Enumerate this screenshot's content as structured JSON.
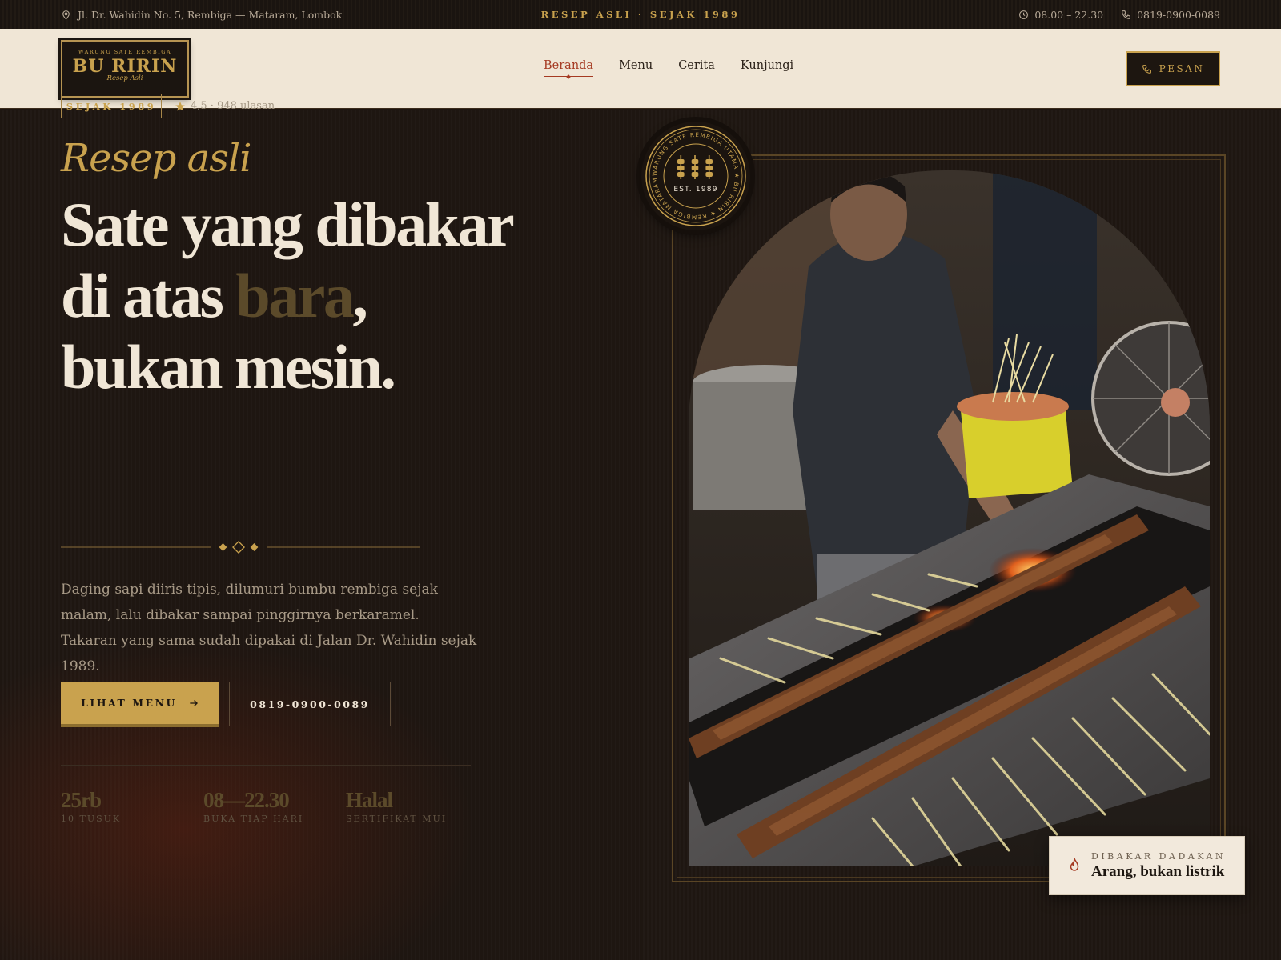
{
  "topbar": {
    "address": "Jl. Dr. Wahidin No. 5, Rembiga — Mataram, Lombok",
    "tagline": "RESEP ASLI · SEJAK 1989",
    "hours": "08.00 – 22.30",
    "phone": "0819-0900-0089",
    "icons": [
      "map-pin-icon",
      "clock-icon",
      "phone-icon"
    ]
  },
  "logo": {
    "small": "WARUNG SATE REMBIGA",
    "name": "BU RIRIN",
    "script": "Resep Asli"
  },
  "nav": {
    "items": [
      {
        "label": "Beranda",
        "active": true
      },
      {
        "label": "Menu",
        "active": false
      },
      {
        "label": "Cerita",
        "active": false
      },
      {
        "label": "Kunjungi",
        "active": false
      }
    ],
    "order_label": "PESAN"
  },
  "hero": {
    "badge": "SEJAK 1989",
    "rating": "4,5 · 948 ulasan",
    "script_title": "Resep asli",
    "headline_1": "Sate yang dibakar",
    "headline_2a": "di atas ",
    "headline_2b": "bara",
    "headline_2c": ",",
    "headline_3": "bukan mesin.",
    "lead": "Daging sapi diiris tipis, dilumuri bumbu rembiga sejak malam, lalu dibakar sampai pinggirnya berkaramel. Takaran yang sama sudah dipakai di Jalan Dr. Wahidin sejak 1989.",
    "cta_primary": "LIHAT MENU",
    "cta_secondary": "0819-0900-0089",
    "stats": [
      {
        "value": "25rb",
        "label": "10 TUSUK"
      },
      {
        "value": "08—22.30",
        "label": "BUKA TIAP HARI"
      },
      {
        "value": "Halal",
        "label": "SERTIFIKAT MUI"
      }
    ]
  },
  "seal": {
    "ring_text": "WARUNG SATE REMBIGA UTAMA ★ BU RIRIN ★ REMBIGA MATARAM ★",
    "est": "EST. 1989"
  },
  "feature_card": {
    "kicker": "DIBAKAR DADAKAN",
    "title": "Arang, bukan listrik"
  },
  "colors": {
    "gold": "#c9a24e",
    "accent_red": "#a53a22",
    "cream": "#f0e6d6",
    "dark": "#1d1610"
  }
}
